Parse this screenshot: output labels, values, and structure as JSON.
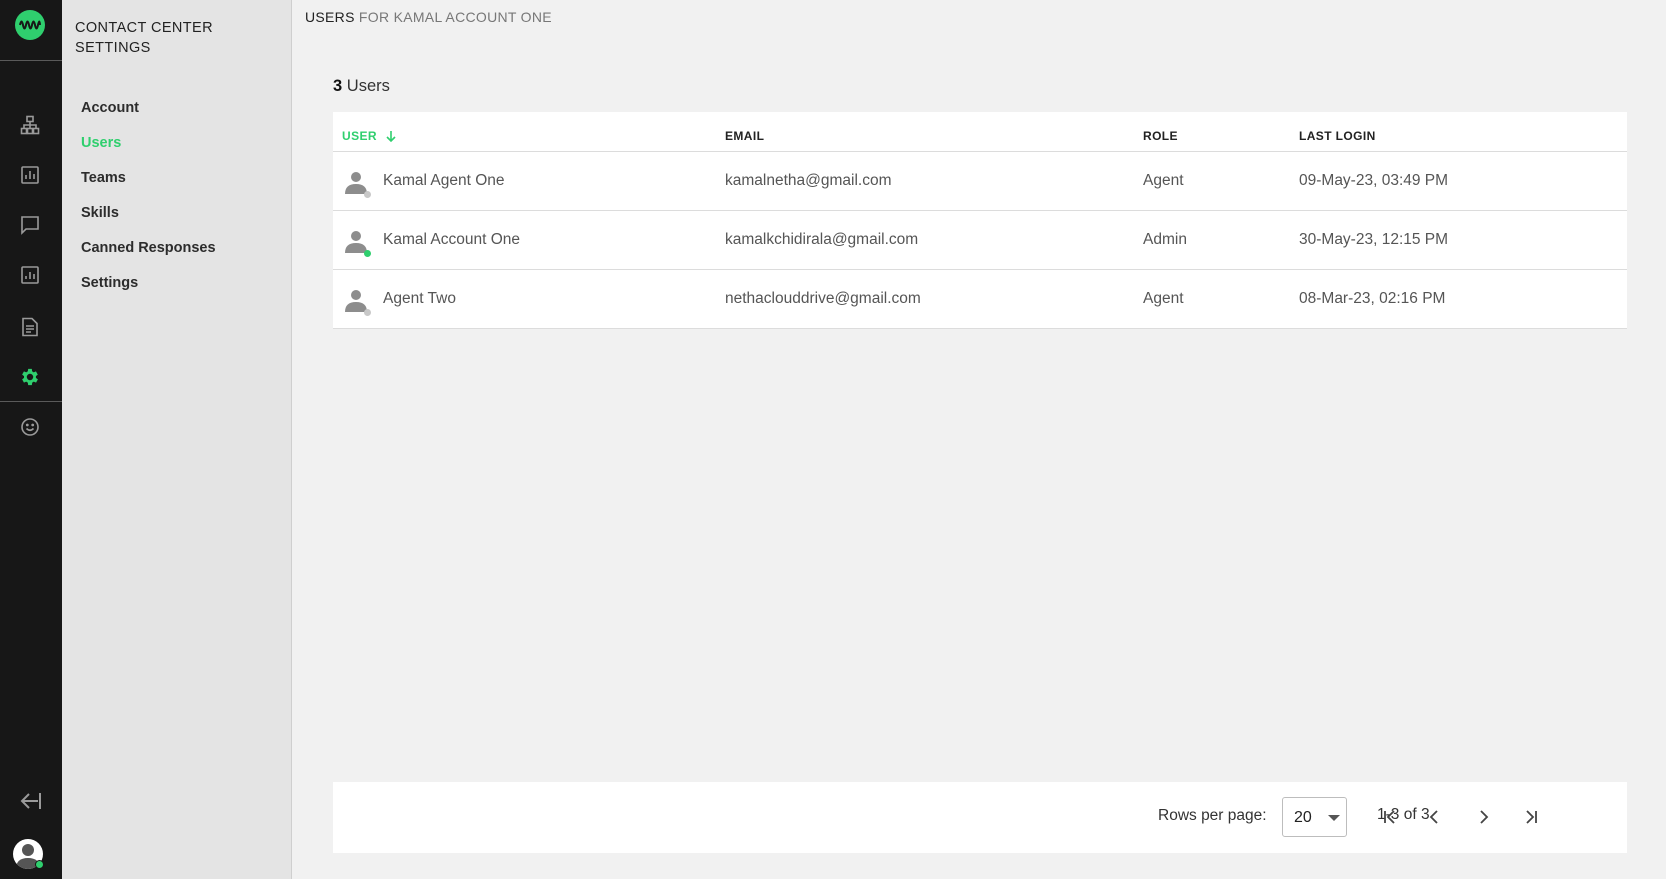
{
  "sidebar": {
    "title": "CONTACT CENTER SETTINGS",
    "items": [
      {
        "label": "Account",
        "active": false
      },
      {
        "label": "Users",
        "active": true
      },
      {
        "label": "Teams",
        "active": false
      },
      {
        "label": "Skills",
        "active": false
      },
      {
        "label": "Canned Responses",
        "active": false
      },
      {
        "label": "Settings",
        "active": false
      }
    ]
  },
  "rail": {
    "icons": [
      "logo-icon",
      "org-chart-icon",
      "analytics-icon",
      "chat-icon",
      "reports-icon",
      "document-icon",
      "gear-icon",
      "smiley-icon",
      "collapse-icon",
      "avatar"
    ]
  },
  "header": {
    "breadcrumb_strong": "USERS",
    "breadcrumb_rest": " FOR KAMAL ACCOUNT ONE"
  },
  "summary": {
    "count": "3",
    "label": " Users"
  },
  "table": {
    "columns": [
      "USER",
      "EMAIL",
      "ROLE",
      "LAST LOGIN"
    ],
    "sort_column": "USER",
    "sort_direction": "descending",
    "rows": [
      {
        "name": "Kamal Agent One",
        "email": "kamalnetha@gmail.com",
        "role": "Agent",
        "last_login": "09-May-23, 03:49 PM",
        "online": false
      },
      {
        "name": "Kamal Account One",
        "email": "kamalkchidirala@gmail.com",
        "role": "Admin",
        "last_login": "30-May-23, 12:15 PM",
        "online": true
      },
      {
        "name": "Agent Two",
        "email": "nethaclouddrive@gmail.com",
        "role": "Agent",
        "last_login": "08-Mar-23, 02:16 PM",
        "online": false
      }
    ]
  },
  "pagination": {
    "rows_per_page_label": "Rows per page:",
    "rows_per_page_value": "20",
    "range_text": "1-3 of 3"
  },
  "colors": {
    "accent": "#2fcf6e",
    "rail_bg": "#171717",
    "sidebar_bg": "#e4e4e4",
    "page_bg": "#f1f1f1",
    "offline_dot": "#c8c8c8"
  }
}
